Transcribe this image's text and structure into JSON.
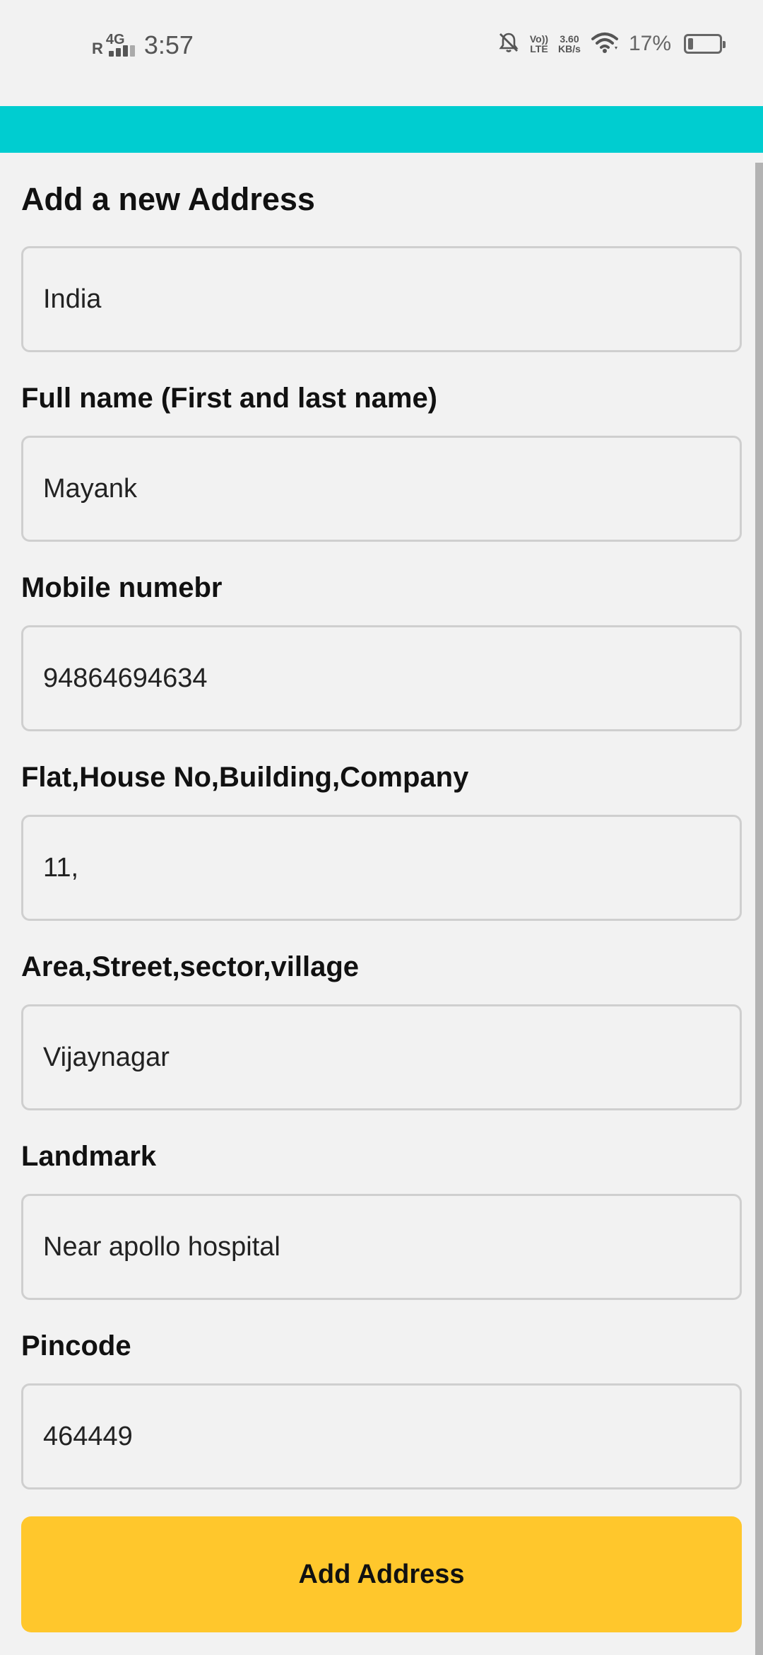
{
  "status_bar": {
    "roaming": "R",
    "network": "4G",
    "time": "3:57",
    "volte_top": "Vo))",
    "volte_bottom": "LTE",
    "speed_value": "3.60",
    "speed_unit": "KB/s",
    "battery_percent": "17%",
    "battery_level": 0.17
  },
  "header": {
    "color": "#00cdd0"
  },
  "form": {
    "title": "Add a new Address",
    "country_value": "India",
    "fields": [
      {
        "label": "Full name (First and last name)",
        "value": "Mayank"
      },
      {
        "label": "Mobile numebr",
        "value": "94864694634"
      },
      {
        "label": "Flat,House No,Building,Company",
        "value": "11,"
      },
      {
        "label": "Area,Street,sector,village",
        "value": "Vijaynagar"
      },
      {
        "label": "Landmark",
        "value": "Near apollo hospital"
      },
      {
        "label": "Pincode",
        "value": "464449"
      }
    ],
    "submit_label": "Add Address",
    "submit_color": "#ffc72c"
  }
}
